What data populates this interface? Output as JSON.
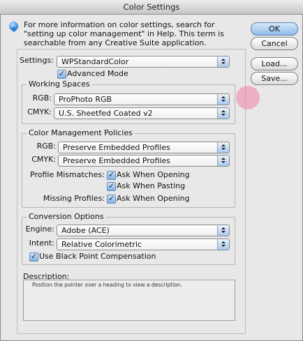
{
  "window": {
    "title": "Color Settings"
  },
  "info": {
    "text": "For more information on color settings, search for \"setting up color management\" in Help. This term is searchable from any Creative Suite application."
  },
  "buttons": {
    "ok": "OK",
    "cancel": "Cancel",
    "load": "Load...",
    "save": "Save..."
  },
  "settings": {
    "label": "Settings:",
    "value": "WPStandardColor",
    "advanced_mode": "Advanced Mode",
    "advanced_checked": true
  },
  "working_spaces": {
    "title": "Working Spaces",
    "rgb_label": "RGB:",
    "rgb_value": "ProPhoto RGB",
    "cmyk_label": "CMYK:",
    "cmyk_value": "U.S. Sheetfed Coated v2"
  },
  "policies": {
    "title": "Color Management Policies",
    "rgb_label": "RGB:",
    "rgb_value": "Preserve Embedded Profiles",
    "cmyk_label": "CMYK:",
    "cmyk_value": "Preserve Embedded Profiles",
    "mismatch_label": "Profile Mismatches:",
    "ask_opening": "Ask When Opening",
    "ask_pasting": "Ask When Pasting",
    "missing_label": "Missing Profiles:",
    "missing_ask_opening": "Ask When Opening"
  },
  "conversion": {
    "title": "Conversion Options",
    "engine_label": "Engine:",
    "engine_value": "Adobe (ACE)",
    "intent_label": "Intent:",
    "intent_value": "Relative Colorimetric",
    "bpc": "Use Black Point Compensation"
  },
  "description": {
    "label": "Description:",
    "text": "Position the pointer over a heading to view a description."
  },
  "colors": {
    "default_button": "#8ebbe9",
    "highlight": "#f27daa"
  }
}
